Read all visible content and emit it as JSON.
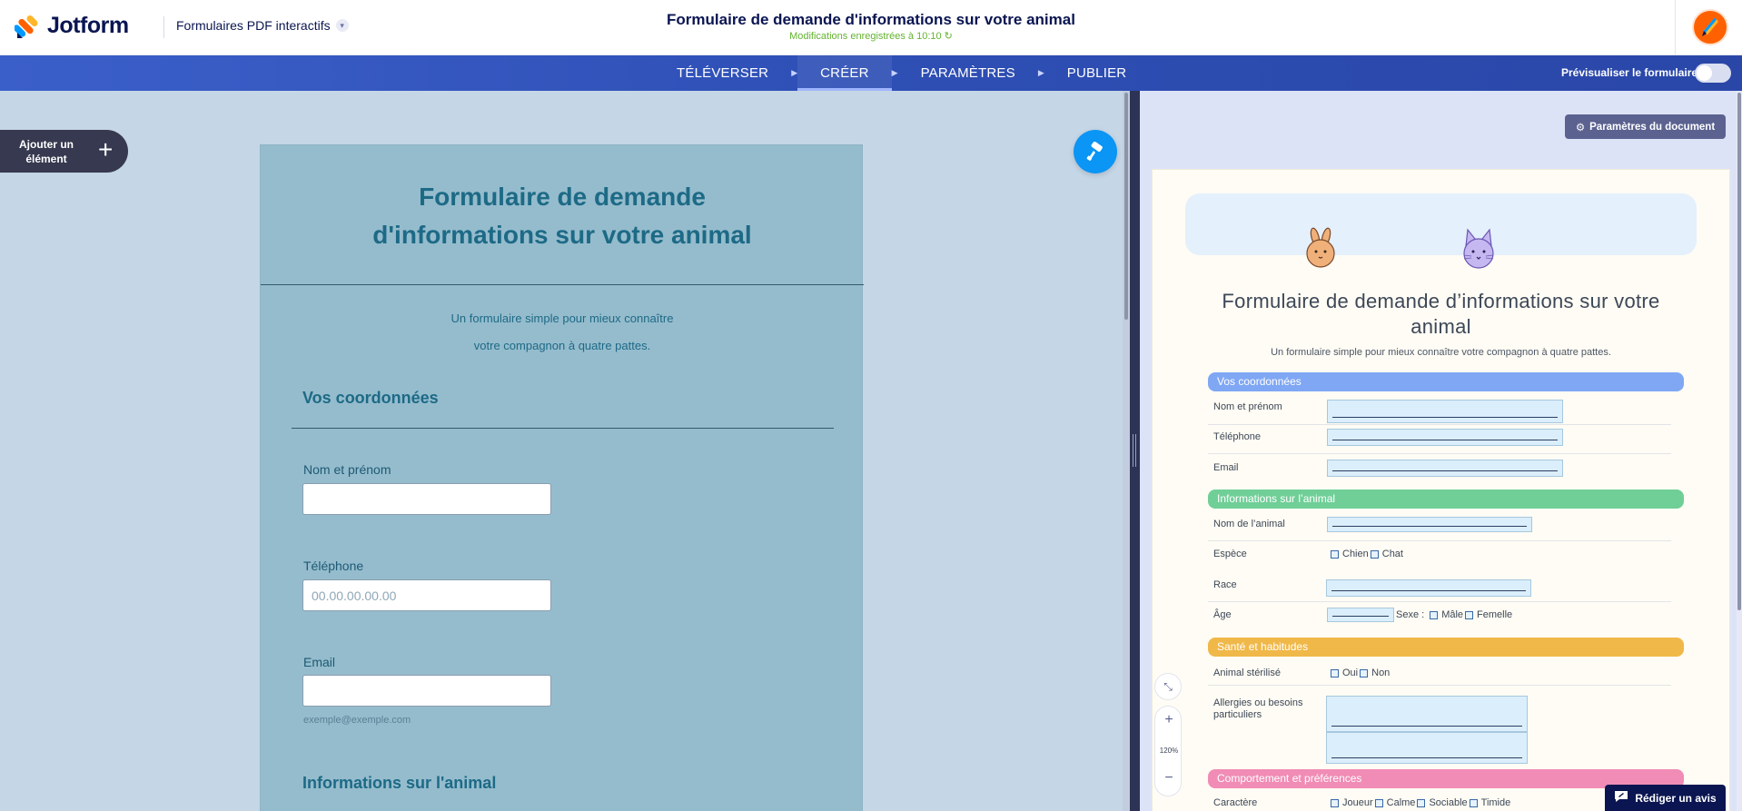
{
  "header": {
    "brand": "Jotform",
    "product": "Formulaires PDF interactifs",
    "title": "Formulaire de demande d'informations sur votre animal",
    "saved_status": "Modifications enregistrées à 10:10 ↻"
  },
  "nav": {
    "tabs": [
      {
        "label": "TÉLÉVERSER",
        "active": false
      },
      {
        "label": "CRÉER",
        "active": true
      },
      {
        "label": "PARAMÈTRES",
        "active": false
      },
      {
        "label": "PUBLIER",
        "active": false
      }
    ],
    "preview_label": "Prévisualiser le formulaire",
    "preview_on": false
  },
  "builder": {
    "add_element": "Ajouter un élément",
    "form_title": "Formulaire de demande d'informations sur votre animal",
    "description_line1": "Un formulaire simple pour mieux connaître",
    "description_line2": "votre compagnon à quatre pattes.",
    "section1": "Vos coordonnées",
    "field_name_label": "Nom et prénom",
    "field_name_value": "",
    "field_phone_label": "Téléphone",
    "field_phone_placeholder": "00.00.00.00.00",
    "field_email_label": "Email",
    "field_email_value": "",
    "field_email_sublabel": "exemple@exemple.com",
    "section2": "Informations sur l'animal"
  },
  "preview": {
    "doc_settings": "Paramètres du document",
    "title": "Formulaire de demande d’informations sur votre animal",
    "subtitle": "Un formulaire simple pour mieux connaître votre compagnon à quatre pattes.",
    "zoom": "120%",
    "sections": {
      "s1": {
        "label": "Vos coordonnées",
        "color": "#7fa7f4"
      },
      "s2": {
        "label": "Informations sur l’animal",
        "color": "#6fcf97"
      },
      "s3": {
        "label": "Santé et habitudes",
        "color": "#f0b849"
      },
      "s4": {
        "label": "Comportement et préférences",
        "color": "#f08cb5"
      }
    },
    "labels": {
      "name": "Nom et prénom",
      "phone": "Téléphone",
      "email": "Email",
      "pet_name": "Nom de l’animal",
      "species": "Espèce",
      "breed": "Race",
      "age": "Âge",
      "sex": "Sexe :",
      "sterilized": "Animal stérilisé",
      "allergies": "Allergies ou besoins particuliers",
      "character": "Caractère"
    },
    "options": {
      "species": [
        "Chien",
        "Chat"
      ],
      "sex": [
        "Mâle",
        "Femelle"
      ],
      "sterilized": [
        "Oui",
        "Non"
      ],
      "character": [
        "Joueur",
        "Calme",
        "Sociable",
        "Timide"
      ]
    },
    "review_button": "Rédiger un avis"
  },
  "colors": {
    "navbar": "#3b5fc9",
    "form_bg": "#95bccd",
    "form_text": "#1d6a86",
    "canvas_bg": "#c5d6e6",
    "paint_button": "#0b95f5"
  },
  "icons": [
    "jotform-logo-icon",
    "chevron-down-icon",
    "refresh-icon",
    "plus-icon",
    "paint-roller-icon",
    "gear-icon",
    "rabbit-icon",
    "cat-icon",
    "collapse-icon",
    "zoom-in-icon",
    "zoom-out-icon",
    "feedback-icon"
  ]
}
